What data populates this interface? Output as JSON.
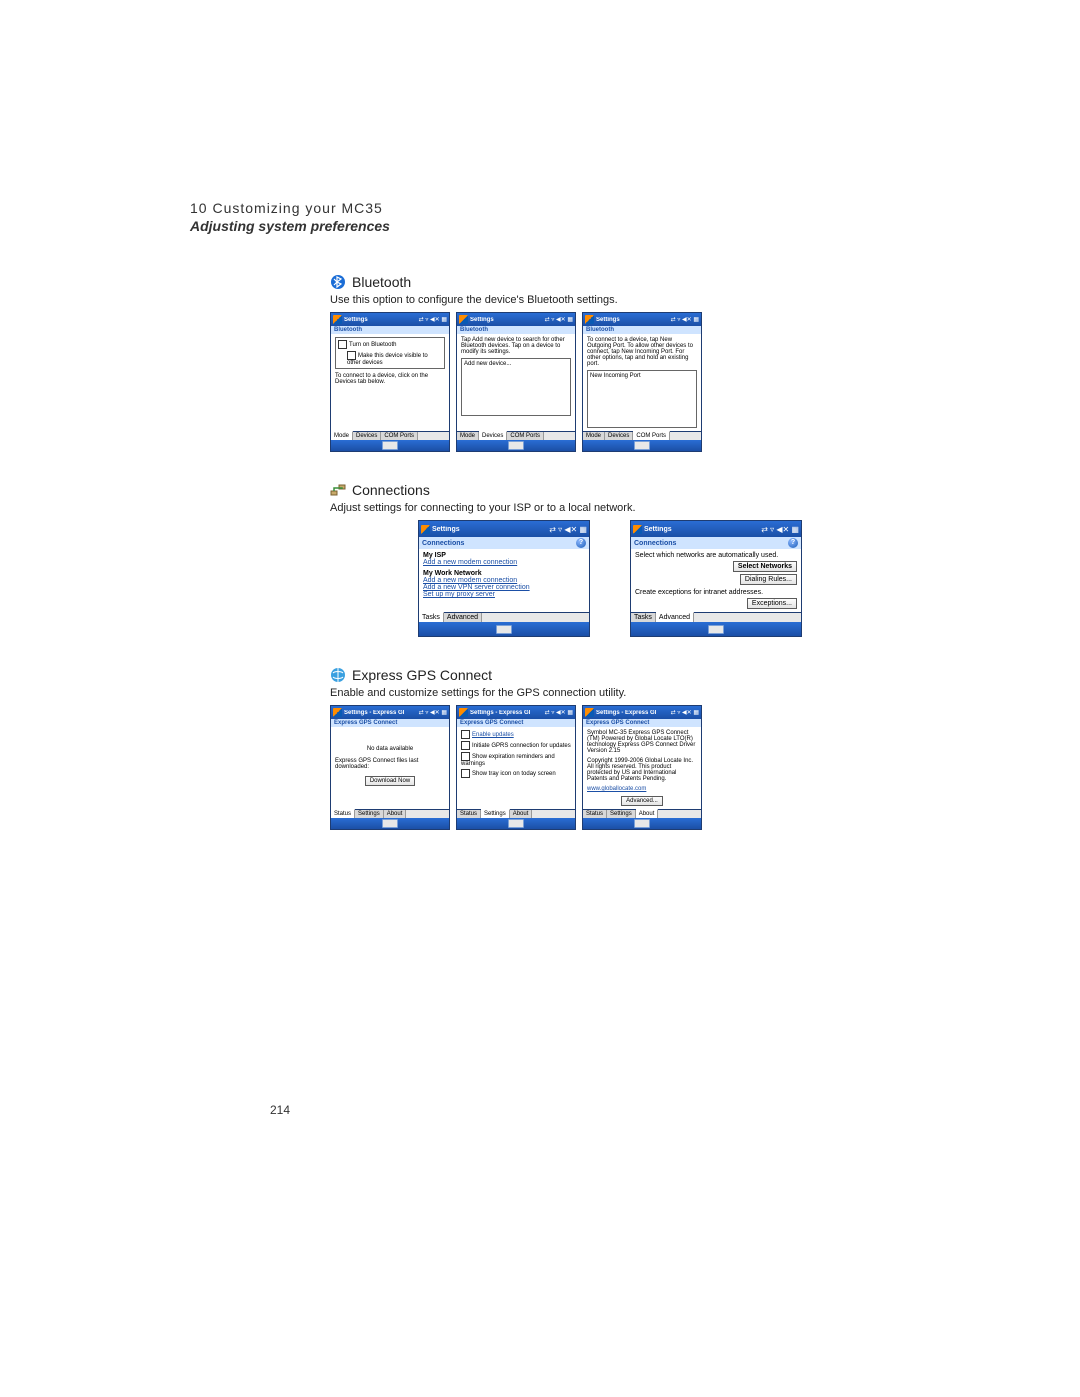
{
  "header": {
    "chapter": "10 Customizing your MC35",
    "subtitle": "Adjusting system preferences"
  },
  "page_number": "214",
  "sections": {
    "bluetooth": {
      "title": "Bluetooth",
      "desc": "Use this option to configure the device's Bluetooth settings.",
      "shots": [
        {
          "titlebar": "Settings",
          "panel": "Bluetooth",
          "checkbox1": "Turn on Bluetooth",
          "checkbox2": "Make this device visible to other devices",
          "hint": "To connect to a device, click on the Devices tab below.",
          "tabs": [
            "Mode",
            "Devices",
            "COM Ports"
          ],
          "active_tab": 0
        },
        {
          "titlebar": "Settings",
          "panel": "Bluetooth",
          "hint": "Tap Add new device to search for other Bluetooth devices. Tap on a device to modify its settings.",
          "listitem": "Add new device...",
          "tabs": [
            "Mode",
            "Devices",
            "COM Ports"
          ],
          "active_tab": 1
        },
        {
          "titlebar": "Settings",
          "panel": "Bluetooth",
          "hint": "To connect to a device, tap New Outgoing Port. To allow other devices to connect, tap New Incoming Port. For other options, tap and hold an existing port.",
          "listitem": "New Incoming Port",
          "tabs": [
            "Mode",
            "Devices",
            "COM Ports"
          ],
          "active_tab": 2
        }
      ]
    },
    "connections": {
      "title": "Connections",
      "desc": "Adjust settings for connecting to your ISP or to a local network.",
      "shots": [
        {
          "titlebar": "Settings",
          "panel": "Connections",
          "isp_title": "My ISP",
          "isp_link": "Add a new modem connection",
          "work_title": "My Work Network",
          "work_link1": "Add a new modem connection",
          "work_link2": "Add a new VPN server connection",
          "work_link3": "Set up my proxy server",
          "tabs": [
            "Tasks",
            "Advanced"
          ],
          "active_tab": 0
        },
        {
          "titlebar": "Settings",
          "panel": "Connections",
          "line1": "Select which networks are automatically used.",
          "btn1": "Select Networks",
          "btn2": "Dialing Rules...",
          "line2": "Create exceptions for intranet addresses.",
          "btn3": "Exceptions...",
          "tabs": [
            "Tasks",
            "Advanced"
          ],
          "active_tab": 1
        }
      ]
    },
    "gps": {
      "title": "Express GPS Connect",
      "desc": "Enable and customize settings for the GPS connection utility.",
      "titlebar": "Settings - Express GI",
      "panel": "Express GPS Connect",
      "shots": [
        {
          "line1": "No data available",
          "line2": "Express GPS Connect files last downloaded:",
          "btn": "Download Now",
          "tabs": [
            "Status",
            "Settings",
            "About"
          ],
          "active_tab": 0
        },
        {
          "chk1": "Enable updates",
          "chk2": "Initiate GPRS connection for updates",
          "chk3": "Show expiration reminders and warnings",
          "chk4": "Show tray icon on today screen",
          "tabs": [
            "Status",
            "Settings",
            "About"
          ],
          "active_tab": 1
        },
        {
          "line1": "Symbol MC-35 Express GPS Connect (TM) Powered by Global Locate LTO(R) technology Express GPS Connect Driver Version 2.15",
          "line2": "Copyright 1999-2006 Global Locate Inc. All rights reserved. This product protected by US and International Patents and Patents Pending.",
          "link": "www.globallocate.com",
          "btn": "Advanced...",
          "tabs": [
            "Status",
            "Settings",
            "About"
          ],
          "active_tab": 2
        }
      ]
    }
  }
}
